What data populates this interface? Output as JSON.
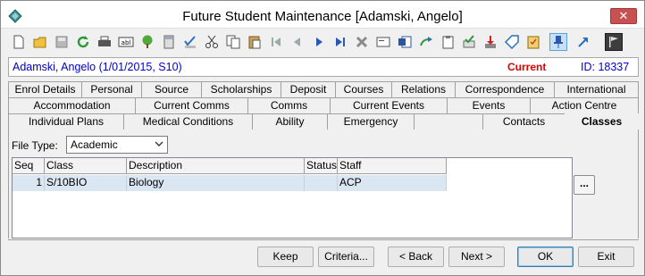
{
  "window": {
    "title": "Future Student Maintenance  [Adamski, Angelo]",
    "close_label": "✕"
  },
  "toolbar": {
    "icons": [
      "new-icon",
      "open-icon",
      "save-icon",
      "refresh-icon",
      "print-icon",
      "abl-icon",
      "tree-icon",
      "calculator-icon",
      "spellcheck-icon",
      "cut-icon",
      "copy-icon",
      "paste-icon",
      "first-record-icon",
      "previous-record-icon",
      "next-record-icon",
      "last-record-icon",
      "delete-icon",
      "card-icon",
      "word-icon",
      "forward-icon",
      "clipboard-icon",
      "approve-icon",
      "download-icon",
      "tag-icon",
      "checklist-icon",
      "pin-icon",
      "arrow-icon",
      "flag-icon"
    ],
    "abl_label": "abl"
  },
  "student": {
    "name": "Adamski, Angelo (1/01/2015, S10)",
    "status": "Current",
    "id": "ID: 18337"
  },
  "tabs": {
    "row1": [
      "Enrol Details",
      "Personal",
      "Source",
      "Scholarships",
      "Deposit",
      "Courses",
      "Relations",
      "Correspondence",
      "International"
    ],
    "row2": [
      "Accommodation",
      "Current Comms",
      "Comms",
      "Current Events",
      "Events",
      "Action Centre"
    ],
    "row3": [
      "Individual Plans",
      "Medical Conditions",
      "Ability",
      "Emergency",
      "",
      "Contacts",
      "Classes"
    ]
  },
  "filter": {
    "label": "File Type:",
    "value": "Academic"
  },
  "grid": {
    "headers": [
      "Seq",
      "Class",
      "Description",
      "Status",
      "Staff"
    ],
    "rows": [
      {
        "seq": "1",
        "class": "S/10BIO",
        "description": "Biology",
        "status": "",
        "staff": "ACP"
      }
    ]
  },
  "ellipsis_label": "...",
  "buttons": {
    "keep": "Keep",
    "criteria": "Criteria...",
    "back": "< Back",
    "next": "Next >",
    "ok": "OK",
    "exit": "Exit"
  },
  "colors": {
    "name_blue": "#0000c8",
    "current_red": "#e00000",
    "selection": "#dbe6f3"
  }
}
